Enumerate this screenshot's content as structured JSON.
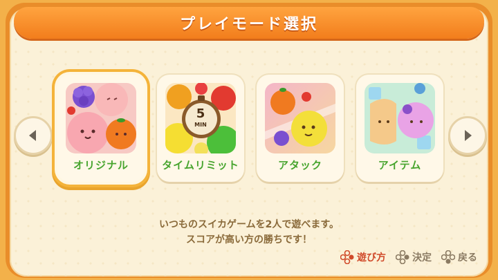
{
  "header": {
    "title": "プレイモード選択"
  },
  "nav": {
    "prev_icon": "chevron-left-icon",
    "next_icon": "chevron-right-icon"
  },
  "modes": [
    {
      "label": "オリジナル",
      "selected": true
    },
    {
      "label": "タイムリミット",
      "selected": false,
      "timer_value": "5",
      "timer_unit": "MIN"
    },
    {
      "label": "アタック",
      "selected": false
    },
    {
      "label": "アイテム",
      "selected": false
    }
  ],
  "description": {
    "line1": "いつものスイカゲームを2人で遊べます。",
    "line2": "スコアが高い方の勝ちです！"
  },
  "footer": {
    "howto": "遊び方",
    "confirm": "決定",
    "back": "戻る"
  },
  "colors": {
    "header": "#f27d1c",
    "label_green": "#46a42d",
    "selected_border": "#f4b33a",
    "active_button": "#d04a2a"
  }
}
